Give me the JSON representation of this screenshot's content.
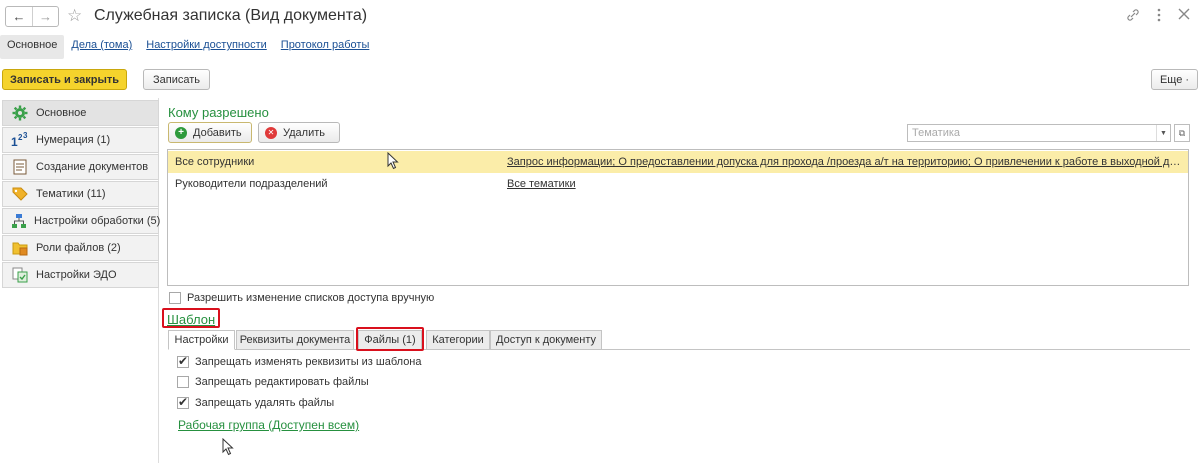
{
  "window": {
    "title": "Служебная записка (Вид документа)",
    "back_icon": "←",
    "forward_icon": "→",
    "star_icon": "☆"
  },
  "nav_tabs": [
    {
      "label": "Основное",
      "active": true
    },
    {
      "label": "Дела (тома)",
      "active": false
    },
    {
      "label": "Настройки доступности",
      "active": false
    },
    {
      "label": "Протокол работы",
      "active": false
    }
  ],
  "toolbar": {
    "save_close_label": "Записать и закрыть",
    "save_label": "Записать",
    "more_label": "Еще ·"
  },
  "sidebar": {
    "items": [
      {
        "label": "Основное",
        "icon": "gear-icon"
      },
      {
        "label": "Нумерация (1)",
        "icon": "numbering-icon"
      },
      {
        "label": "Создание документов",
        "icon": "document-icon"
      },
      {
        "label": "Тематики (11)",
        "icon": "tag-icon"
      },
      {
        "label": "Настройки обработки (5)",
        "icon": "workflow-icon"
      },
      {
        "label": "Роли файлов (2)",
        "icon": "folder-icon"
      },
      {
        "label": "Настройки ЭДО",
        "icon": "edo-icon"
      }
    ]
  },
  "access": {
    "title": "Кому разрешено",
    "add_label": "Добавить",
    "delete_label": "Удалить",
    "topic_placeholder": "Тематика",
    "rows": [
      {
        "who": "Все сотрудники",
        "topics": "Запрос информации; О предоставлении допуска для прохода /проезда а/т на территорию; О привлечении к работе в выходной день; ..."
      },
      {
        "who": "Руководители подразделений",
        "topics": "Все тематики"
      }
    ],
    "manual_change_label": "Разрешить изменение списков доступа вручную"
  },
  "template": {
    "link": "Шаблон",
    "tabs": [
      "Настройки",
      "Реквизиты документа",
      "Файлы (1)",
      "Категории",
      "Доступ к документу"
    ],
    "options": [
      {
        "label": "Запрещать изменять реквизиты из шаблона",
        "checked": true
      },
      {
        "label": "Запрещать редактировать файлы",
        "checked": false
      },
      {
        "label": "Запрещать удалять файлы",
        "checked": true
      }
    ],
    "workgroup_link": "Рабочая группа (Доступен всем)"
  }
}
